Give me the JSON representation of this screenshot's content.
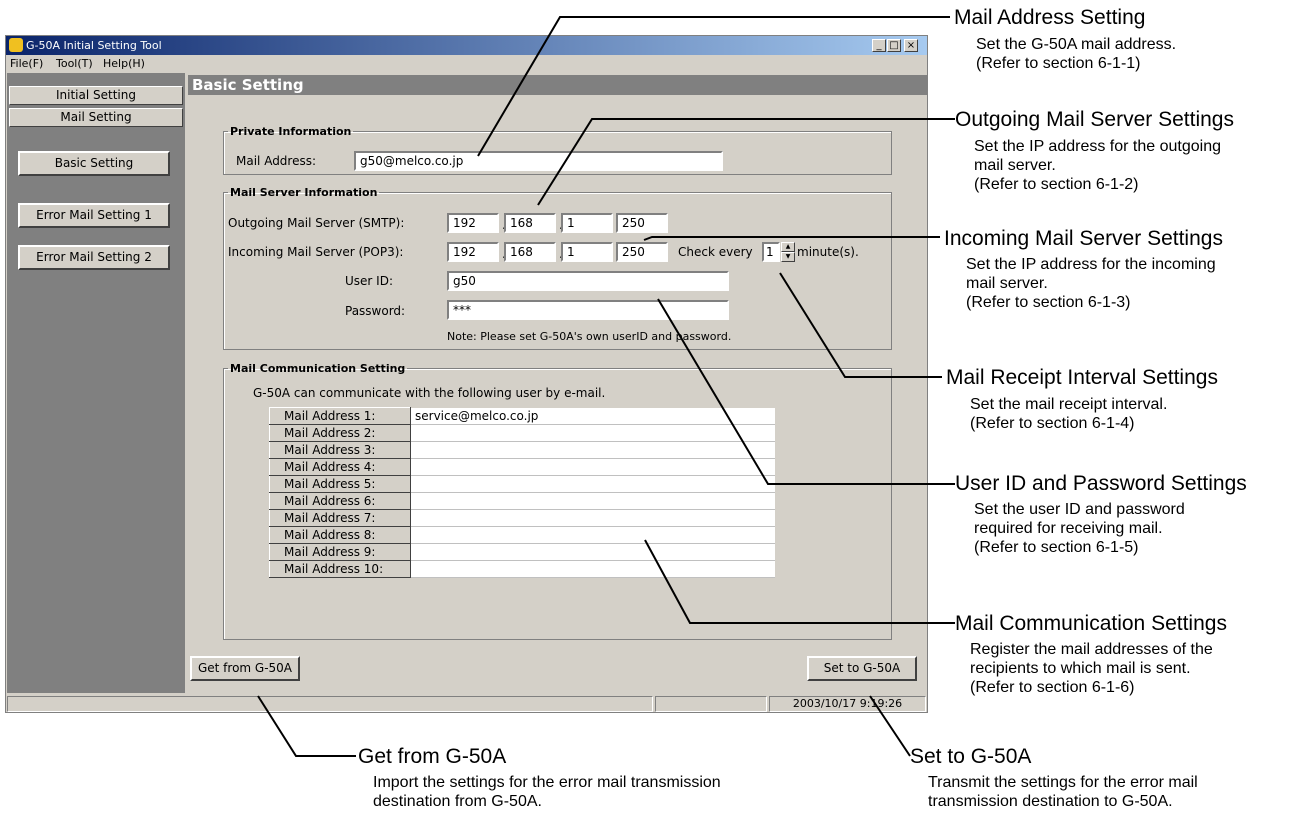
{
  "window": {
    "title": "G-50A Initial Setting Tool",
    "minimize": "_",
    "maximize": "□",
    "close": "×"
  },
  "menu": [
    "File(F)",
    "Tool(T)",
    "Help(H)"
  ],
  "sidebar": {
    "tabs": [
      "Initial Setting",
      "Mail Setting"
    ],
    "buttons": [
      "Basic Setting",
      "Error Mail Setting 1",
      "Error Mail Setting 2"
    ]
  },
  "header": {
    "title": "Basic Setting"
  },
  "private_info": {
    "legend": "Private Information",
    "label": "Mail Address:",
    "value": "g50@melco.co.jp"
  },
  "mail_server": {
    "legend": "Mail Server Information",
    "smtp_label": "Outgoing Mail Server (SMTP):",
    "smtp_ip": [
      "192",
      "168",
      "1",
      "250"
    ],
    "pop3_label": "Incoming Mail Server (POP3):",
    "pop3_ip": [
      "192",
      "168",
      "1",
      "250"
    ],
    "check_every": "Check every",
    "interval": "1",
    "minutes": "minute(s).",
    "userid_label": "User ID:",
    "userid": "g50",
    "password_label": "Password:",
    "password": "***",
    "note": "Note: Please set G-50A's own userID and password."
  },
  "comm": {
    "legend": "Mail Communication Setting",
    "intro": "G-50A can communicate with the following user by e-mail.",
    "rows": [
      {
        "label": "Mail Address 1:",
        "value": "service@melco.co.jp"
      },
      {
        "label": "Mail Address 2:",
        "value": ""
      },
      {
        "label": "Mail Address 3:",
        "value": ""
      },
      {
        "label": "Mail Address 4:",
        "value": ""
      },
      {
        "label": "Mail Address 5:",
        "value": ""
      },
      {
        "label": "Mail Address 6:",
        "value": ""
      },
      {
        "label": "Mail Address 7:",
        "value": ""
      },
      {
        "label": "Mail Address 8:",
        "value": ""
      },
      {
        "label": "Mail Address 9:",
        "value": ""
      },
      {
        "label": "Mail Address 10:",
        "value": ""
      }
    ]
  },
  "buttons": {
    "get": "Get from G-50A",
    "set": "Set to G-50A"
  },
  "status": {
    "datetime": "2003/10/17 9:19:26"
  },
  "callouts": [
    {
      "title": "Mail Address Setting",
      "desc": [
        "Set the G-50A mail address.",
        "(Refer to section 6-1-1)"
      ]
    },
    {
      "title": "Outgoing Mail Server Settings",
      "desc": [
        "Set the IP address for the outgoing",
        "mail server.",
        "(Refer to section 6-1-2)"
      ]
    },
    {
      "title": "Incoming Mail Server Settings",
      "desc": [
        "Set the IP address for the incoming",
        "mail server.",
        "(Refer to section 6-1-3)"
      ]
    },
    {
      "title": "Mail Receipt Interval Settings",
      "desc": [
        "Set the mail receipt interval.",
        "(Refer to section 6-1-4)"
      ]
    },
    {
      "title": "User ID and Password Settings",
      "desc": [
        "Set the user ID and password",
        "required for receiving mail.",
        "(Refer  to section 6-1-5)"
      ]
    },
    {
      "title": "Mail Communication Settings",
      "desc": [
        "Register the mail addresses of the",
        "recipients to which mail is sent.",
        "(Refer to section 6-1-6)"
      ]
    },
    {
      "title": "Get from G-50A",
      "desc": [
        "Import the settings for the error mail transmission",
        "destination from G-50A."
      ]
    },
    {
      "title": "Set to G-50A",
      "desc": [
        "Transmit the settings for the error mail",
        "transmission destination to G-50A."
      ]
    }
  ]
}
